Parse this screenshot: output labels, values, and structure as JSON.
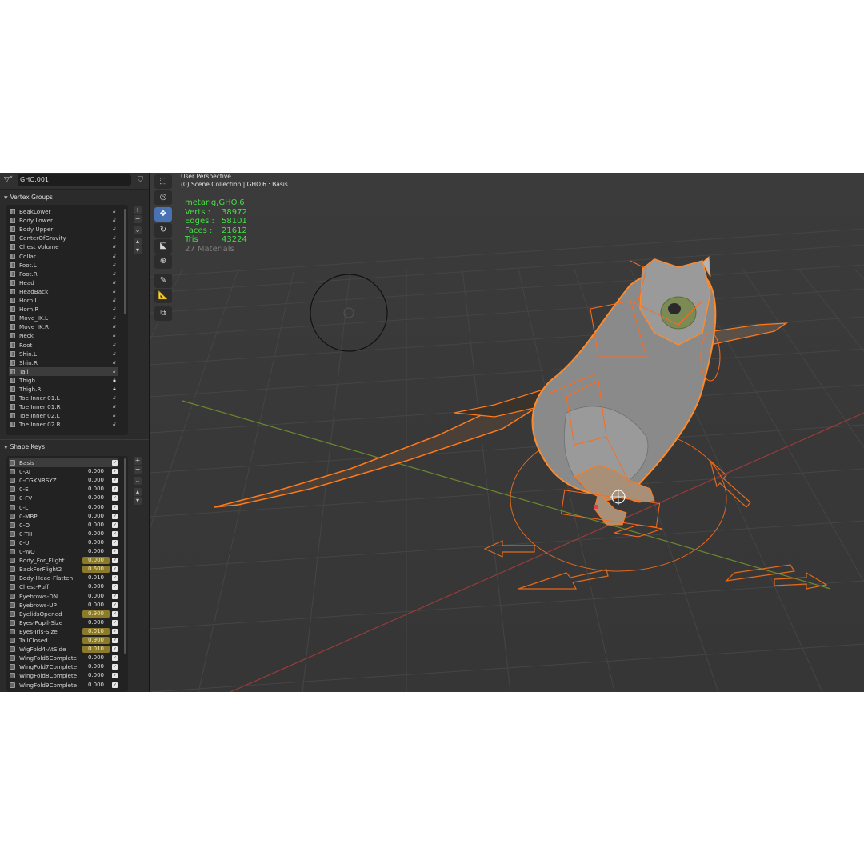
{
  "header": {
    "object_name": "GHO.001"
  },
  "vertex_groups": {
    "title": "Vertex Groups",
    "items": [
      {
        "label": "BeakLower",
        "locked": false
      },
      {
        "label": "Body Lower",
        "locked": false
      },
      {
        "label": "Body Upper",
        "locked": false
      },
      {
        "label": "CenterOfGravity",
        "locked": false
      },
      {
        "label": "Chest Volume",
        "locked": false
      },
      {
        "label": "Collar",
        "locked": false
      },
      {
        "label": "Foot.L",
        "locked": false
      },
      {
        "label": "Foot.R",
        "locked": false
      },
      {
        "label": "Head",
        "locked": false
      },
      {
        "label": "HeadBack",
        "locked": false
      },
      {
        "label": "Horn.L",
        "locked": false
      },
      {
        "label": "Horn.R",
        "locked": false
      },
      {
        "label": "Move_IK.L",
        "locked": false
      },
      {
        "label": "Move_IK.R",
        "locked": false
      },
      {
        "label": "Neck",
        "locked": false
      },
      {
        "label": "Root",
        "locked": false
      },
      {
        "label": "Shin.L",
        "locked": false
      },
      {
        "label": "Shin.R",
        "locked": false
      },
      {
        "label": "Tail",
        "locked": false,
        "selected": true
      },
      {
        "label": "Thigh.L",
        "locked": true
      },
      {
        "label": "Thigh.R",
        "locked": true
      },
      {
        "label": "Toe Inner 01.L",
        "locked": false
      },
      {
        "label": "Toe Inner 01.R",
        "locked": false
      },
      {
        "label": "Toe Inner 02.L",
        "locked": false
      },
      {
        "label": "Toe Inner 02.R",
        "locked": false
      }
    ]
  },
  "shape_keys": {
    "title": "Shape Keys",
    "items": [
      {
        "label": "Basis",
        "value": "",
        "selected": true
      },
      {
        "label": "0-AI",
        "value": "0.000"
      },
      {
        "label": "0-CGKNRSYZ",
        "value": "0.000"
      },
      {
        "label": "0-E",
        "value": "0.000"
      },
      {
        "label": "0-FV",
        "value": "0.000"
      },
      {
        "label": "0-L",
        "value": "0.000"
      },
      {
        "label": "0-MBP",
        "value": "0.000"
      },
      {
        "label": "0-O",
        "value": "0.000"
      },
      {
        "label": "0-TH",
        "value": "0.000"
      },
      {
        "label": "0-U",
        "value": "0.000"
      },
      {
        "label": "0-WQ",
        "value": "0.000"
      },
      {
        "label": "Body_For_Flight",
        "value": "0.000",
        "highlight": true
      },
      {
        "label": "BackForFlight2",
        "value": "0.600",
        "highlight": true
      },
      {
        "label": "Body-Head-Flatten",
        "value": "0.010"
      },
      {
        "label": "Chest-Puff",
        "value": "0.000"
      },
      {
        "label": "Eyebrows-DN",
        "value": "0.000"
      },
      {
        "label": "Eyebrows-UP",
        "value": "0.000"
      },
      {
        "label": "EyelidsOpened",
        "value": "0.900",
        "highlight": true
      },
      {
        "label": "Eyes-Pupil-Size",
        "value": "0.000"
      },
      {
        "label": "Eyes-Iris-Size",
        "value": "0.010",
        "highlight": true
      },
      {
        "label": "TailClosed",
        "value": "0.900",
        "highlight": true
      },
      {
        "label": "WigFold4-AtSide",
        "value": "0.010",
        "highlight": true
      },
      {
        "label": "WingFold6Complete",
        "value": "0.000"
      },
      {
        "label": "WingFold7Complete",
        "value": "0.000"
      },
      {
        "label": "WingFold8Complete",
        "value": "0.000"
      },
      {
        "label": "WingFold9Complete",
        "value": "0.000"
      }
    ]
  },
  "viewport": {
    "view_name": "User Perspective",
    "collection_info": "(0) Scene Collection | GHO.6 : Basis",
    "stats": {
      "objects": "metarig,GHO.6",
      "verts_label": "Verts :",
      "verts": "38972",
      "edges_label": "Edges :",
      "edges": "58101",
      "faces_label": "Faces :",
      "faces": "21612",
      "tris_label": "Tris :",
      "tris": "43224",
      "materials": "27 Materials"
    }
  },
  "colors": {
    "accent_blue": "#4872b3",
    "selection_orange": "#ff6a1a",
    "stats_green": "#44e044",
    "highlight_field": "#8a7a2a"
  }
}
